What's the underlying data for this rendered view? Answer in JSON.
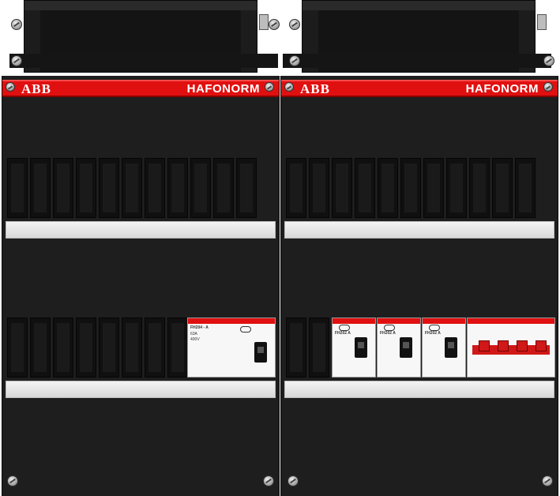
{
  "panels": [
    {
      "logo": "ABB",
      "brand": "HAFONORM"
    },
    {
      "logo": "ABB",
      "brand": "HAFONORM"
    }
  ],
  "devices": {
    "left_rcd": {
      "title": "FH204 - A",
      "line1": "63A",
      "line2": "400V"
    },
    "right_breakers": [
      {
        "title": "FH202 A"
      },
      {
        "title": "FH202 A"
      },
      {
        "title": "FH202 A"
      }
    ]
  },
  "colors": {
    "accent_red": "#e01010",
    "panel_black": "#1e1e1e"
  }
}
